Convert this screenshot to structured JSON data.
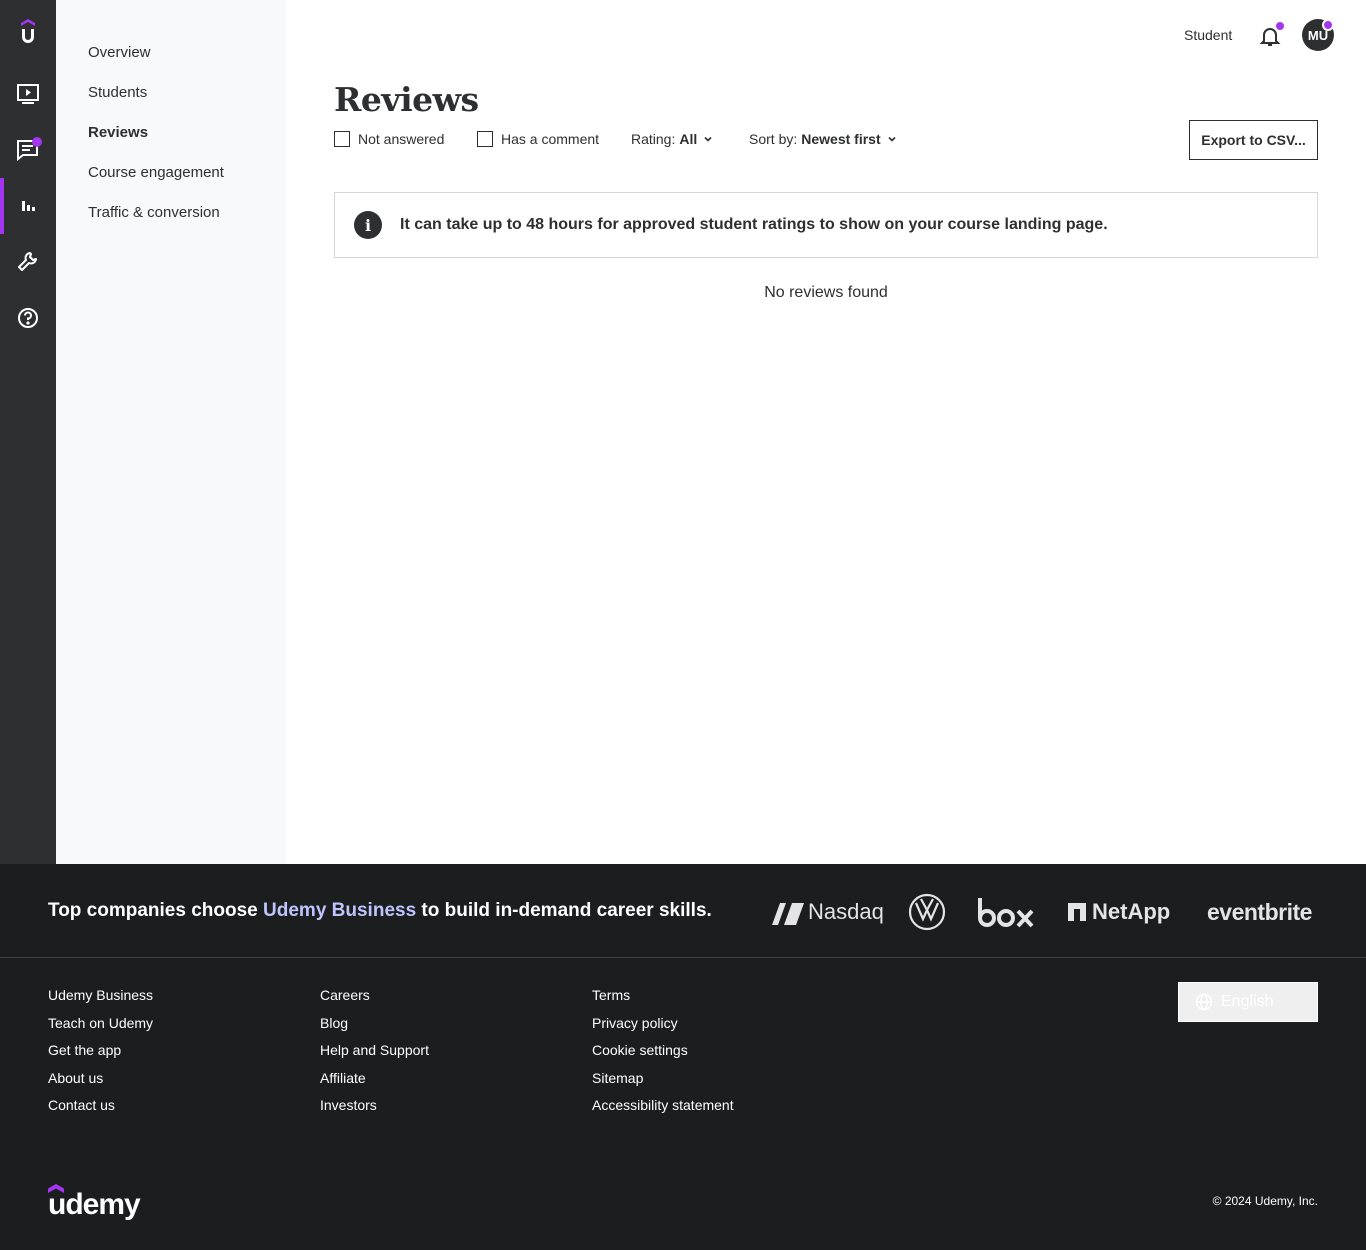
{
  "rail": {
    "items": [
      {
        "name": "udemy-logo-icon"
      },
      {
        "name": "courses-icon"
      },
      {
        "name": "communication-icon"
      },
      {
        "name": "performance-icon"
      },
      {
        "name": "tools-icon"
      },
      {
        "name": "help-icon"
      }
    ],
    "accent": "#a435f0"
  },
  "subnav": {
    "items": [
      {
        "label": "Overview"
      },
      {
        "label": "Students"
      },
      {
        "label": "Reviews"
      },
      {
        "label": "Course engagement"
      },
      {
        "label": "Traffic & conversion"
      }
    ]
  },
  "header": {
    "student_label": "Student",
    "avatar_initials": "MU"
  },
  "main": {
    "title": "Reviews",
    "filters": {
      "not_answered": "Not answered",
      "has_comment": "Has a comment",
      "rating_label": "Rating:",
      "rating_value": "All",
      "sort_label": "Sort by:",
      "sort_value": "Newest first"
    },
    "export_label": "Export to CSV...",
    "alert_text": "It can take up to 48 hours for approved student ratings to show on your course landing page.",
    "empty_text": "No reviews found"
  },
  "footer": {
    "tagline_pre": "Top companies choose ",
    "tagline_accent": "Udemy Business",
    "tagline_post": " to build in-demand career skills.",
    "partner_logos": [
      "Nasdaq",
      "NetApp",
      "eventbrite"
    ],
    "col1": [
      "Udemy Business",
      "Teach on Udemy",
      "Get the app",
      "About us",
      "Contact us"
    ],
    "col2": [
      "Careers",
      "Blog",
      "Help and Support",
      "Affiliate",
      "Investors"
    ],
    "col3": [
      "Terms",
      "Privacy policy",
      "Cookie settings",
      "Sitemap",
      "Accessibility statement"
    ],
    "language": "English",
    "brand": "udemy",
    "copyright": "© 2024 Udemy, Inc."
  }
}
